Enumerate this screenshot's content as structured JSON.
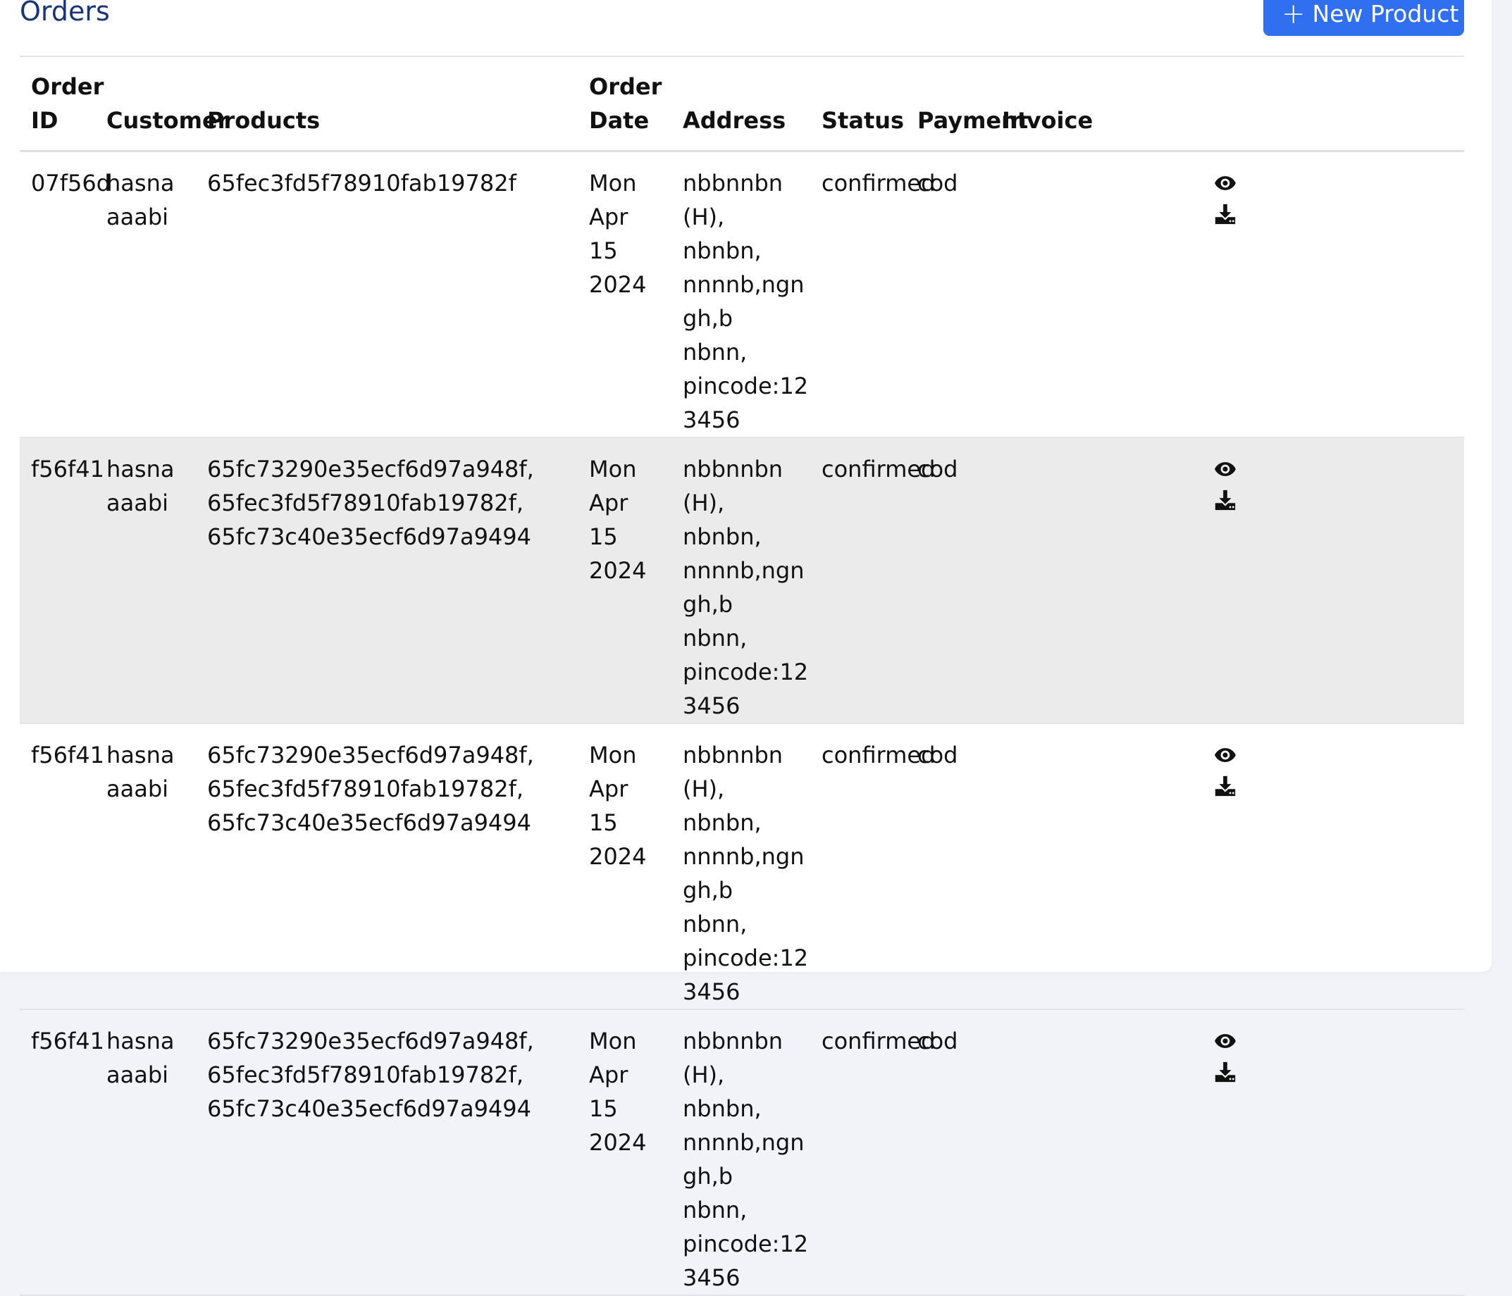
{
  "page": {
    "title": "Orders",
    "new_button_label": "New Product"
  },
  "table": {
    "headers": {
      "order_id_line1": "Order",
      "order_id_line2": "ID",
      "customer": "Customer",
      "products": "Products",
      "order_date_line1": "Order",
      "order_date_line2": "Date",
      "address": "Address",
      "status": "Status",
      "payment": "Payment",
      "invoice": "Invoice"
    },
    "rows": [
      {
        "order_id": "07f56d",
        "customer_first": "hasna",
        "customer_last": "aaabi",
        "products": [
          "65fec3fd5f78910fab19782f"
        ],
        "date_line1": "Mon Apr",
        "date_line2": "15 2024",
        "address": [
          "nbbnnbn (H),",
          "nbnbn,",
          "nnnnb,ngngh,b",
          "nbnn,",
          "pincode:123456"
        ],
        "status": "confirmed",
        "payment": "cod"
      },
      {
        "order_id": "f56f41",
        "customer_first": "hasna",
        "customer_last": "aaabi",
        "products": [
          "65fc73290e35ecf6d97a948f,",
          "65fec3fd5f78910fab19782f,",
          "65fc73c40e35ecf6d97a9494"
        ],
        "date_line1": "Mon Apr",
        "date_line2": "15 2024",
        "address": [
          "nbbnnbn (H),",
          "nbnbn,",
          "nnnnb,ngngh,b",
          "nbnn,",
          "pincode:123456"
        ],
        "status": "confirmed",
        "payment": "cod"
      },
      {
        "order_id": "f56f41",
        "customer_first": "hasna",
        "customer_last": "aaabi",
        "products": [
          "65fc73290e35ecf6d97a948f,",
          "65fec3fd5f78910fab19782f,",
          "65fc73c40e35ecf6d97a9494"
        ],
        "date_line1": "Mon Apr",
        "date_line2": "15 2024",
        "address": [
          "nbbnnbn (H),",
          "nbnbn,",
          "nnnnb,ngngh,b",
          "nbnn,",
          "pincode:123456"
        ],
        "status": "confirmed",
        "payment": "cod"
      },
      {
        "order_id": "f56f41",
        "customer_first": "hasna",
        "customer_last": "aaabi",
        "products": [
          "65fc73290e35ecf6d97a948f,",
          "65fec3fd5f78910fab19782f,",
          "65fc73c40e35ecf6d97a9494"
        ],
        "date_line1": "Mon Apr",
        "date_line2": "15 2024",
        "address": [
          "nbbnnbn (H),",
          "nbnbn,",
          "nnnnb,ngngh,b",
          "nbnn,",
          "pincode:123456"
        ],
        "status": "confirmed",
        "payment": "cod"
      }
    ]
  },
  "icons": {
    "view": "eye-icon",
    "download": "download-icon"
  },
  "colors": {
    "title": "#1a3478",
    "button": "#2f6ff0",
    "shaded_row": "#ebebeb",
    "background": "#f1f3f9"
  }
}
